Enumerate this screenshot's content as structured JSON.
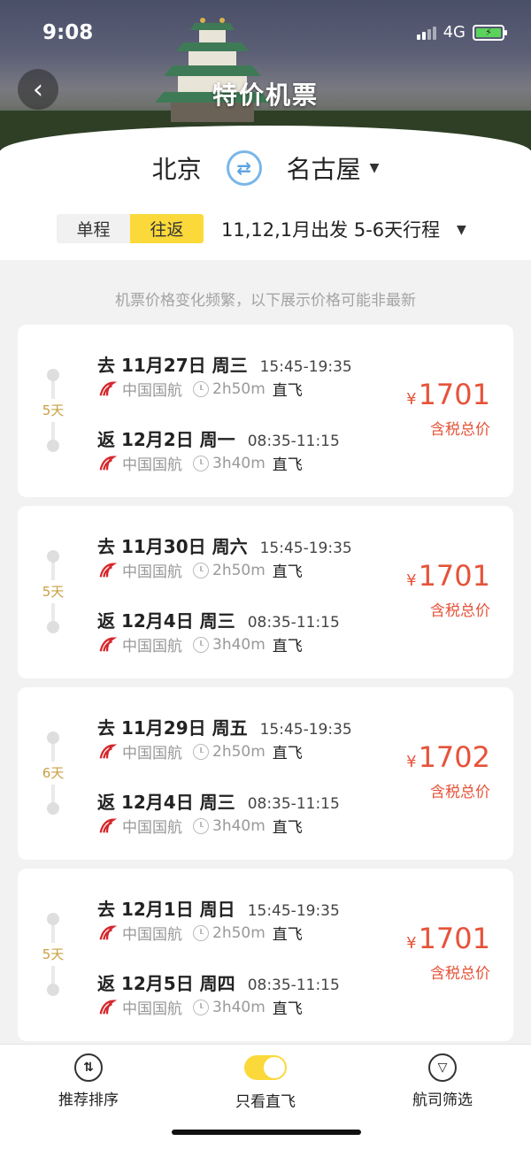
{
  "status_bar": {
    "time": "9:08",
    "network": "4G"
  },
  "header": {
    "title": "特价机票"
  },
  "route": {
    "origin": "北京",
    "destination": "名古屋"
  },
  "trip_type": {
    "options": [
      "单程",
      "往返"
    ],
    "selected": "往返"
  },
  "trip_filter": {
    "label": "11,12,1月出发 5-6天行程"
  },
  "notice": "机票价格变化频繁，以下展示价格可能非最新",
  "cards": [
    {
      "days": "5天",
      "out": {
        "date": "去 11月27日 周三",
        "time": "15:45-19:35",
        "airline": "中国国航",
        "duration": "2h50m",
        "type": "直飞"
      },
      "ret": {
        "date": "返 12月2日 周一",
        "time": "08:35-11:15",
        "airline": "中国国航",
        "duration": "3h40m",
        "type": "直飞"
      },
      "currency": "¥",
      "price": "1701",
      "price_note": "含税总价"
    },
    {
      "days": "5天",
      "out": {
        "date": "去 11月30日 周六",
        "time": "15:45-19:35",
        "airline": "中国国航",
        "duration": "2h50m",
        "type": "直飞"
      },
      "ret": {
        "date": "返 12月4日 周三",
        "time": "08:35-11:15",
        "airline": "中国国航",
        "duration": "3h40m",
        "type": "直飞"
      },
      "currency": "¥",
      "price": "1701",
      "price_note": "含税总价"
    },
    {
      "days": "6天",
      "out": {
        "date": "去 11月29日 周五",
        "time": "15:45-19:35",
        "airline": "中国国航",
        "duration": "2h50m",
        "type": "直飞"
      },
      "ret": {
        "date": "返 12月4日 周三",
        "time": "08:35-11:15",
        "airline": "中国国航",
        "duration": "3h40m",
        "type": "直飞"
      },
      "currency": "¥",
      "price": "1702",
      "price_note": "含税总价"
    },
    {
      "days": "5天",
      "out": {
        "date": "去 12月1日 周日",
        "time": "15:45-19:35",
        "airline": "中国国航",
        "duration": "2h50m",
        "type": "直飞"
      },
      "ret": {
        "date": "返 12月5日 周四",
        "time": "08:35-11:15",
        "airline": "中国国航",
        "duration": "3h40m",
        "type": "直飞"
      },
      "currency": "¥",
      "price": "1701",
      "price_note": "含税总价"
    }
  ],
  "bottom_bar": {
    "sort": "推荐排序",
    "direct_only": "只看直飞",
    "direct_only_on": true,
    "airline_filter": "航司筛选"
  },
  "colors": {
    "accent_yellow": "#fbd93b",
    "price_red": "#e6533a",
    "swap_blue": "#5aa3e0"
  }
}
